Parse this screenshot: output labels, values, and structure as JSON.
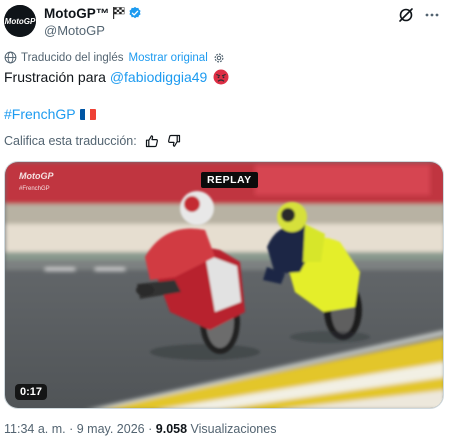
{
  "author": {
    "display_name": "MotoGP™",
    "handle": "@MotoGP",
    "avatar_logo": "MotoGP",
    "verified_color": "#1d9bf0"
  },
  "header_icons": [
    "grok-slash-icon",
    "more-icon"
  ],
  "translation": {
    "label": "Traducido del inglés",
    "show_original": "Mostrar original"
  },
  "tweet": {
    "text_before": "Frustración para ",
    "mention": "@fabiodiggia49",
    "emoji": "angry-face",
    "hashtag": "#FrenchGP",
    "flag": "France"
  },
  "rate_translation": {
    "label": "Califica esta traducción:"
  },
  "video": {
    "overlay_logo": "MotoGP",
    "overlay_logo_sub": "#FrenchGP",
    "replay_label": "REPLAY",
    "duration": "0:17"
  },
  "meta": {
    "time": "11:34 a. m.",
    "separator": "·",
    "date": "9 may. 2026",
    "views_count": "9.058",
    "views_label": "Visualizaciones"
  },
  "colors": {
    "accent": "#1d9bf0",
    "text": "#0f1419",
    "secondary": "#536471"
  }
}
